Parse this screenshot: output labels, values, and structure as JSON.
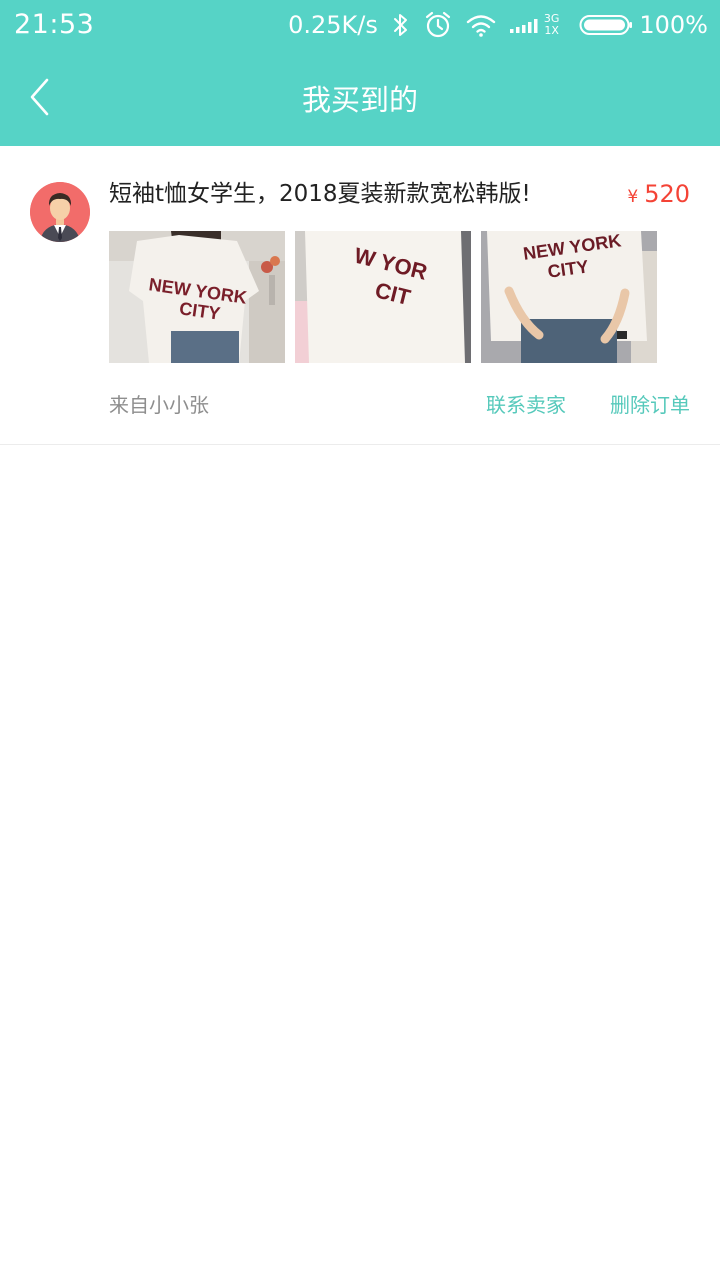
{
  "status_bar": {
    "time": "21:53",
    "net_speed": "0.25K/s",
    "network_top": "3G",
    "network_bottom": "1X",
    "battery": "100%"
  },
  "header": {
    "title": "我买到的",
    "back_icon": "chevron-left-icon"
  },
  "colors": {
    "accent": "#56d3c6",
    "price": "#f44336",
    "action": "#56c9bb"
  },
  "order": {
    "title": "短袖t恤女学生，2018夏装新款宽松韩版!",
    "price_currency": "¥",
    "price_value": "520",
    "photos": [
      "product-photo-1",
      "product-photo-2",
      "product-photo-3"
    ],
    "from_label": "来自小小张",
    "contact_seller": "联系卖家",
    "delete_order": "删除订单"
  }
}
